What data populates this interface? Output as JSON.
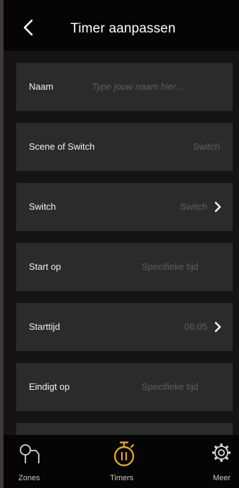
{
  "header": {
    "title": "Timer aanpassen"
  },
  "form": {
    "name": {
      "label": "Naam",
      "placeholder": "Type jouw naam hier..."
    },
    "scene_or_switch": {
      "label": "Scene of Switch",
      "value": "Switch"
    },
    "switch": {
      "label": "Switch",
      "value": "Switch"
    },
    "start_on": {
      "label": "Start op",
      "value": "Specifieke tijd"
    },
    "start_time": {
      "label": "Starttijd",
      "value": "06:05"
    },
    "ends_on": {
      "label": "Eindigt op",
      "value": "Specifieke tijd"
    }
  },
  "tabs": {
    "zones": {
      "label": "Zones",
      "icon": "zones-icon"
    },
    "timers": {
      "label": "Timers",
      "icon": "timer-icon",
      "active": true
    },
    "more": {
      "label": "Meer",
      "icon": "gear-icon"
    }
  },
  "colors": {
    "accent": "#e6a820",
    "row_bg": "#2b2b2b",
    "header_bg": "#050505"
  }
}
